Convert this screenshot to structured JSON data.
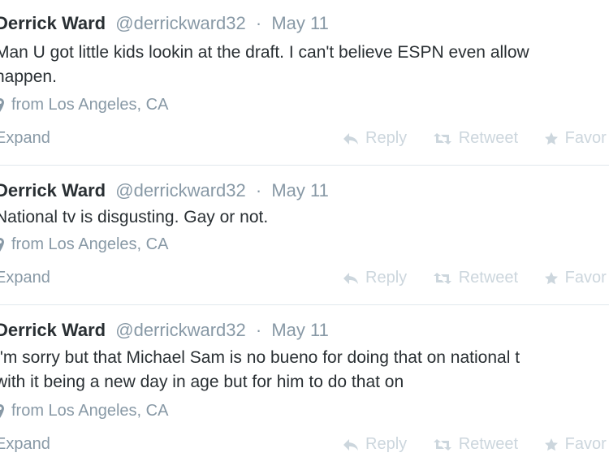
{
  "tweets": [
    {
      "name": "Derrick Ward",
      "handle": "@derrickward32",
      "sep": "·",
      "date": "May 11",
      "lines": [
        "Man U got little kids lookin at the draft. I can't believe ESPN even allow",
        "happen."
      ],
      "location": "from Los Angeles, CA",
      "expand": "Expand",
      "reply": "Reply",
      "retweet": "Retweet",
      "favorite": "Favor"
    },
    {
      "name": "Derrick Ward",
      "handle": "@derrickward32",
      "sep": "·",
      "date": "May 11",
      "lines": [
        "National tv is disgusting. Gay or not."
      ],
      "location": "from Los Angeles, CA",
      "expand": "Expand",
      "reply": "Reply",
      "retweet": "Retweet",
      "favorite": "Favor"
    },
    {
      "name": "Derrick Ward",
      "handle": "@derrickward32",
      "sep": "·",
      "date": "May 11",
      "lines": [
        "I'm sorry but that Michael Sam is no bueno for doing that on national t",
        "with it being a new day in age but for him to do that on"
      ],
      "location": "from Los Angeles, CA",
      "expand": "Expand",
      "reply": "Reply",
      "retweet": "Retweet",
      "favorite": "Favor"
    }
  ]
}
